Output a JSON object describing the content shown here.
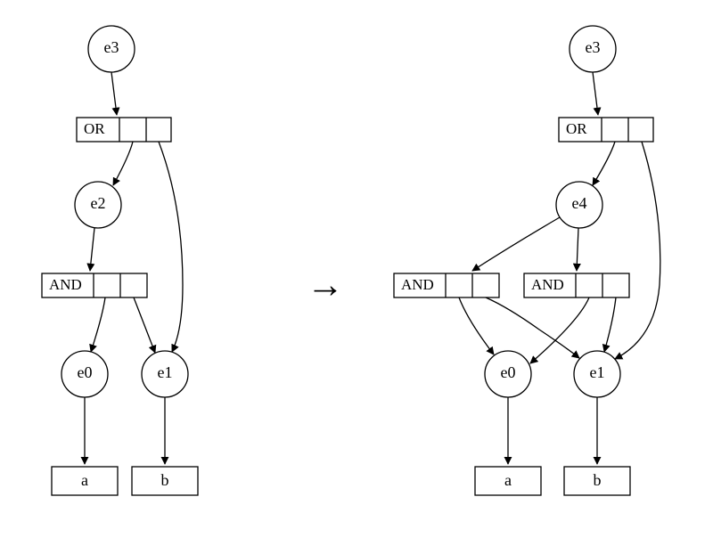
{
  "transformArrow": "→",
  "left": {
    "root": {
      "label": "e3"
    },
    "or": {
      "label": "OR"
    },
    "e2": {
      "label": "e2"
    },
    "and": {
      "label": "AND"
    },
    "e0": {
      "label": "e0"
    },
    "e1": {
      "label": "e1"
    },
    "a": {
      "label": "a"
    },
    "b": {
      "label": "b"
    }
  },
  "right": {
    "root": {
      "label": "e3"
    },
    "or": {
      "label": "OR"
    },
    "e4": {
      "label": "e4"
    },
    "andL": {
      "label": "AND"
    },
    "andR": {
      "label": "AND"
    },
    "e0": {
      "label": "e0"
    },
    "e1": {
      "label": "e1"
    },
    "a": {
      "label": "a"
    },
    "b": {
      "label": "b"
    }
  }
}
